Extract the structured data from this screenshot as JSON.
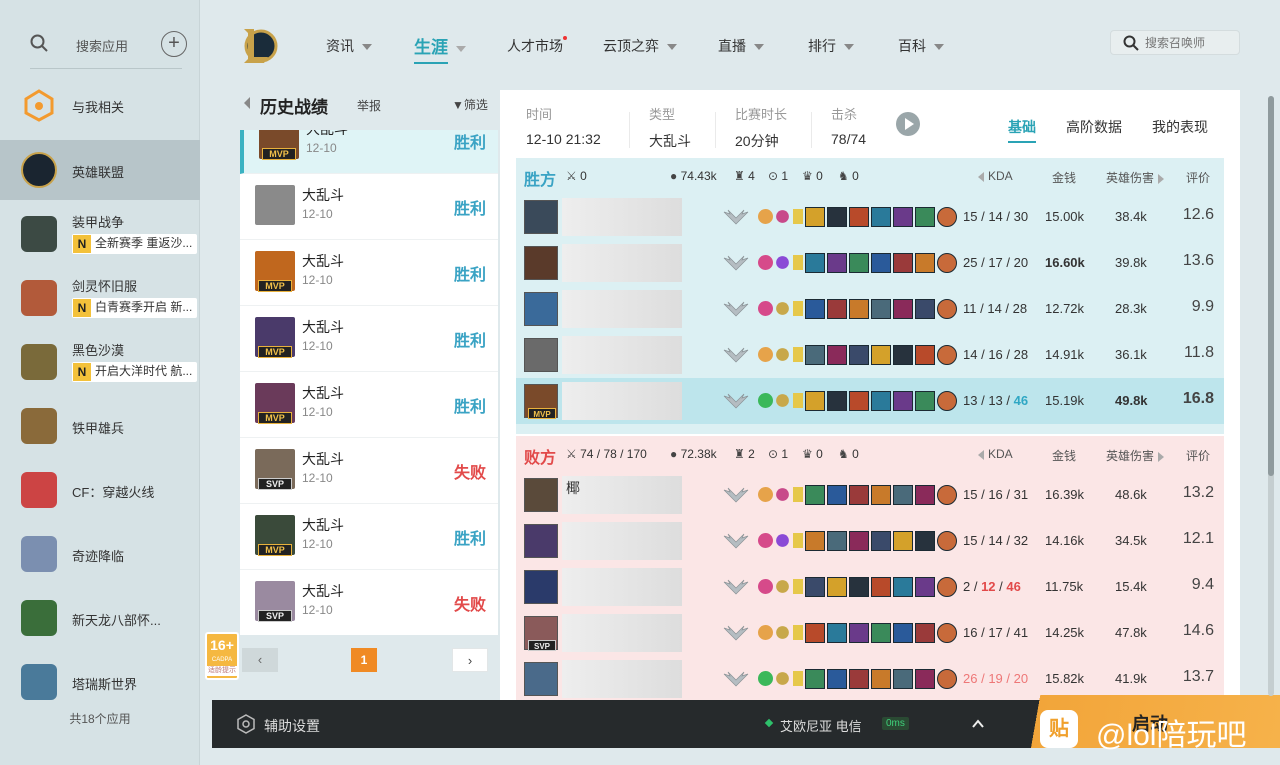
{
  "sidebar": {
    "search_label": "搜索应用",
    "items": [
      {
        "name": "与我相关",
        "icon": "notify-icon",
        "color": "#f39a2e"
      },
      {
        "name": "英雄联盟",
        "icon": "lol-icon",
        "color": "#1a2530"
      },
      {
        "name": "装甲战争",
        "icon": "armored-warfare-icon",
        "color": "#3c4a44",
        "notice": "全新赛季 重返沙..."
      },
      {
        "name": "剑灵怀旧服",
        "icon": "blade-soul-icon",
        "color": "#b25a3a",
        "notice": "白青赛季开启 新..."
      },
      {
        "name": "黑色沙漠",
        "icon": "black-desert-icon",
        "color": "#7a6a3a",
        "notice": "开启大洋时代 航..."
      },
      {
        "name": "铁甲雄兵",
        "icon": "for-honor-icon",
        "color": "#8a6a3a"
      },
      {
        "name": "CF：穿越火线",
        "icon": "crossfire-icon",
        "color": "#c44"
      },
      {
        "name": "奇迹降临",
        "icon": "miracle-icon",
        "color": "#7b8fb0"
      },
      {
        "name": "新天龙八部怀...",
        "icon": "tianlong-icon",
        "color": "#3a6e3a"
      },
      {
        "name": "塔瑞斯世界",
        "icon": "tarisland-icon",
        "color": "#4a7a9a"
      }
    ],
    "count_label": "共18个应用",
    "notice_badge": "N"
  },
  "age_badge": {
    "age": "16+",
    "org": "CADPA",
    "label": "适龄提示"
  },
  "nav": {
    "items": [
      {
        "label": "资讯",
        "chevron": true
      },
      {
        "label": "生涯",
        "chevron": true,
        "active": true
      },
      {
        "label": "人才市场",
        "dot": true
      },
      {
        "label": "云顶之弈",
        "chevron": true
      },
      {
        "label": "直播",
        "chevron": true
      },
      {
        "label": "排行",
        "chevron": true
      },
      {
        "label": "百科",
        "chevron": true
      }
    ],
    "search_placeholder": "搜索召唤师"
  },
  "history": {
    "title": "历史战绩",
    "report": "举报",
    "filter": "筛选",
    "matches": [
      {
        "mode": "大乱斗",
        "date": "12-10",
        "result": "胜利",
        "win": true,
        "tag": "MVP",
        "color": "#7a4a2a",
        "selected": true
      },
      {
        "mode": "大乱斗",
        "date": "12-10",
        "result": "胜利",
        "win": true,
        "tag": "",
        "color": "#8a8a8a"
      },
      {
        "mode": "大乱斗",
        "date": "12-10",
        "result": "胜利",
        "win": true,
        "tag": "MVP",
        "color": "#c0671e"
      },
      {
        "mode": "大乱斗",
        "date": "12-10",
        "result": "胜利",
        "win": true,
        "tag": "MVP",
        "color": "#4a3a6a"
      },
      {
        "mode": "大乱斗",
        "date": "12-10",
        "result": "胜利",
        "win": true,
        "tag": "MVP",
        "color": "#6a3a5a"
      },
      {
        "mode": "大乱斗",
        "date": "12-10",
        "result": "失败",
        "win": false,
        "tag": "SVP",
        "color": "#7a6a5a"
      },
      {
        "mode": "大乱斗",
        "date": "12-10",
        "result": "胜利",
        "win": true,
        "tag": "MVP",
        "color": "#3a4a3a"
      },
      {
        "mode": "大乱斗",
        "date": "12-10",
        "result": "失败",
        "win": false,
        "tag": "SVP",
        "color": "#9a8aa0"
      }
    ],
    "page": "1"
  },
  "detail": {
    "info": [
      {
        "key": "时间",
        "value": "12-10 21:32"
      },
      {
        "key": "类型",
        "value": "大乱斗"
      },
      {
        "key": "比赛时长",
        "value": "20分钟"
      },
      {
        "key": "击杀",
        "value": "78/74"
      }
    ],
    "tabs": [
      "基础",
      "高阶数据",
      "我的表现"
    ],
    "teams": [
      {
        "name": "胜方",
        "win": true,
        "kills_fragment": "0",
        "gold": "74.43k",
        "towers": "4",
        "inhibitors": "1",
        "barons": "0",
        "dragons": "0",
        "col_kda": "KDA",
        "col_gold": "金钱",
        "col_damage": "英雄伤害",
        "col_rating": "评价",
        "players": [
          {
            "kda": [
              "15",
              "14",
              "30"
            ],
            "gold": "15.00k",
            "damage": "38.4k",
            "rating": "12.6",
            "color": "#3a4a5a"
          },
          {
            "kda": [
              "25",
              "17",
              "20"
            ],
            "gold": "16.60k",
            "damage": "39.8k",
            "rating": "13.6",
            "color": "#5a3a2a",
            "gold_hi": true
          },
          {
            "kda": [
              "11",
              "14",
              "28"
            ],
            "gold": "12.72k",
            "damage": "28.3k",
            "rating": "9.9",
            "color": "#3a6a9a"
          },
          {
            "kda": [
              "14",
              "16",
              "28"
            ],
            "gold": "14.91k",
            "damage": "36.1k",
            "rating": "11.8",
            "color": "#6a6a6a"
          },
          {
            "kda": [
              "13",
              "13",
              "46"
            ],
            "gold": "15.19k",
            "damage": "49.8k",
            "rating": "16.8",
            "color": "#7a4a2a",
            "mvp": true,
            "self": true
          }
        ]
      },
      {
        "name": "败方",
        "win": false,
        "kills_fragment": "74 / 78 / 170",
        "gold": "72.38k",
        "towers": "2",
        "inhibitors": "1",
        "barons": "0",
        "dragons": "0",
        "col_kda": "KDA",
        "col_gold": "金钱",
        "col_damage": "英雄伤害",
        "col_rating": "评价",
        "players": [
          {
            "kda": [
              "15",
              "16",
              "31"
            ],
            "gold": "16.39k",
            "damage": "48.6k",
            "rating": "13.2",
            "color": "#5a4a3a",
            "name_frag": "椰"
          },
          {
            "kda": [
              "15",
              "14",
              "32"
            ],
            "gold": "14.16k",
            "damage": "34.5k",
            "rating": "12.1",
            "color": "#4a3a6a"
          },
          {
            "kda": [
              "2",
              "12",
              "46"
            ],
            "gold": "11.75k",
            "damage": "15.4k",
            "rating": "9.4",
            "color": "#2a3a6a",
            "red_da": true
          },
          {
            "kda": [
              "16",
              "17",
              "41"
            ],
            "gold": "14.25k",
            "damage": "47.8k",
            "rating": "14.6",
            "color": "#8a5a5a",
            "svp": true
          },
          {
            "kda": [
              "26",
              "19",
              "20"
            ],
            "gold": "15.82k",
            "damage": "41.9k",
            "rating": "13.7",
            "color": "#4a6a8a",
            "partial": true
          }
        ]
      }
    ]
  },
  "footer": {
    "assist": "辅助设置",
    "server": "艾欧尼亚 电信",
    "ping": "0ms",
    "launch": "启动"
  },
  "watermark": {
    "logo": "贴",
    "text": "@lol陪玩吧"
  },
  "colors": {
    "accent": "#2aa3b5",
    "win": "#3aa3c4",
    "lose": "#e24a4a",
    "orange": "#f08a24"
  }
}
